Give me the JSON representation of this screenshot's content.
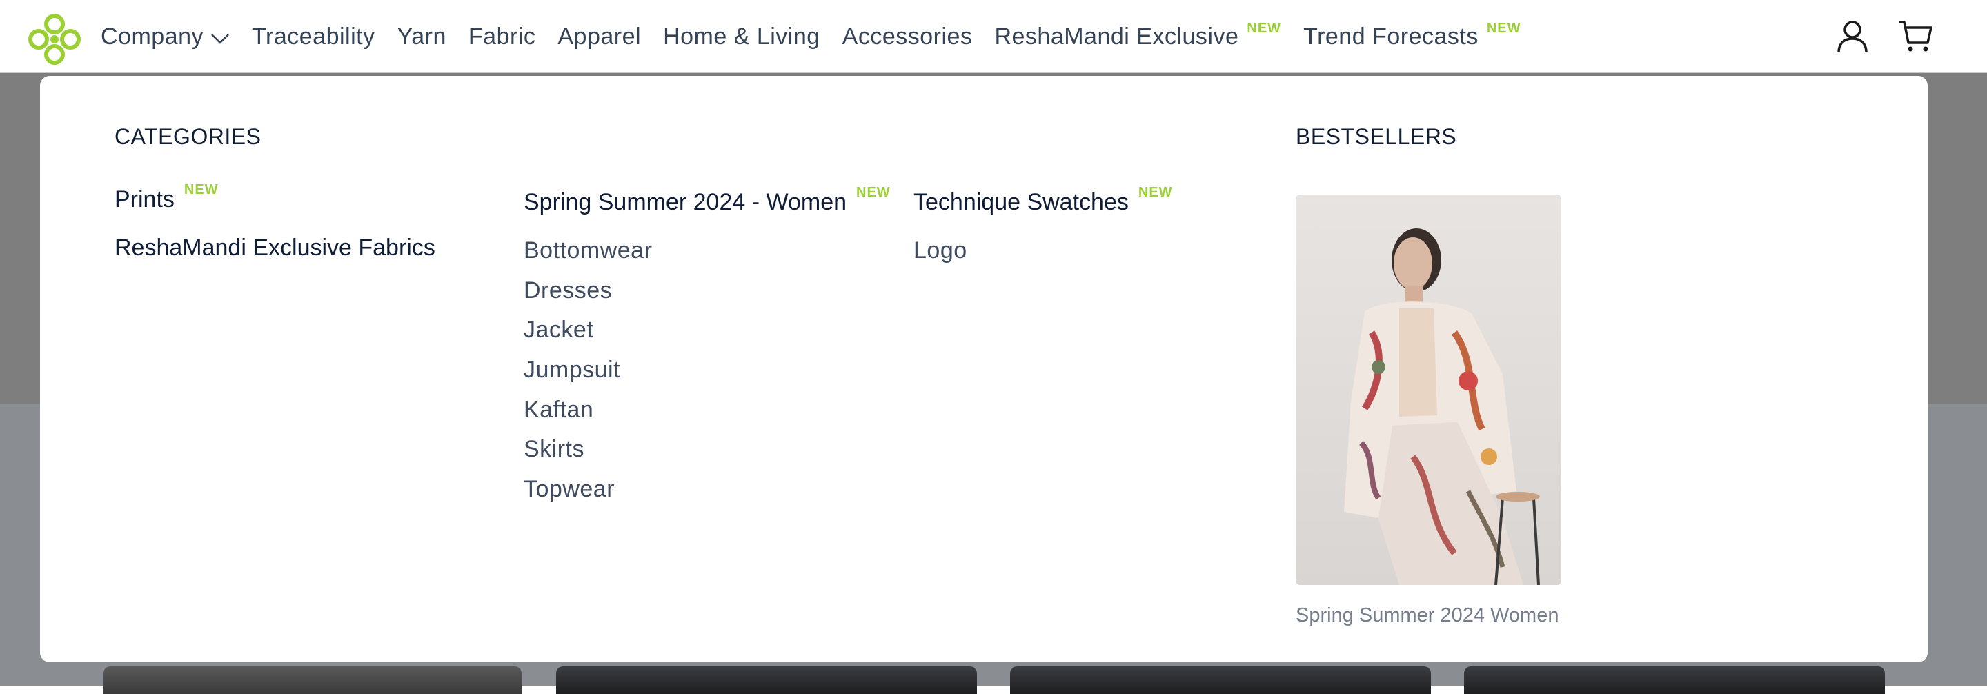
{
  "header": {
    "logo_icon": "resha-mandi-clover-logo-icon",
    "nav": [
      {
        "label": "Company",
        "has_dropdown": true
      },
      {
        "label": "Traceability"
      },
      {
        "label": "Yarn"
      },
      {
        "label": "Fabric"
      },
      {
        "label": "Apparel"
      },
      {
        "label": "Home & Living"
      },
      {
        "label": "Accessories"
      },
      {
        "label": "ReshaMandi Exclusive",
        "badge": "NEW"
      },
      {
        "label": "Trend Forecasts",
        "badge": "NEW"
      }
    ],
    "icons": {
      "account": "user-icon",
      "cart": "cart-icon"
    }
  },
  "menu": {
    "categories_heading": "CATEGORIES",
    "categories": [
      {
        "label": "Prints",
        "badge": "NEW"
      },
      {
        "label": "ReshaMandi Exclusive Fabrics"
      }
    ],
    "collections": [
      {
        "title": "Spring Summer 2024 - Women",
        "badge": "NEW",
        "items": [
          "Bottomwear",
          "Dresses",
          "Jacket",
          "Jumpsuit",
          "Kaftan",
          "Skirts",
          "Topwear"
        ]
      },
      {
        "title": "Technique Swatches",
        "badge": "NEW",
        "items": [
          "Logo"
        ]
      }
    ],
    "bestsellers_heading": "BESTSELLERS",
    "bestseller": {
      "caption": "Spring Summer 2024 Women"
    }
  },
  "colors": {
    "brand_green": "#9bd035",
    "nav_text": "#334255",
    "overlay_dark": "#7e7e7e"
  }
}
